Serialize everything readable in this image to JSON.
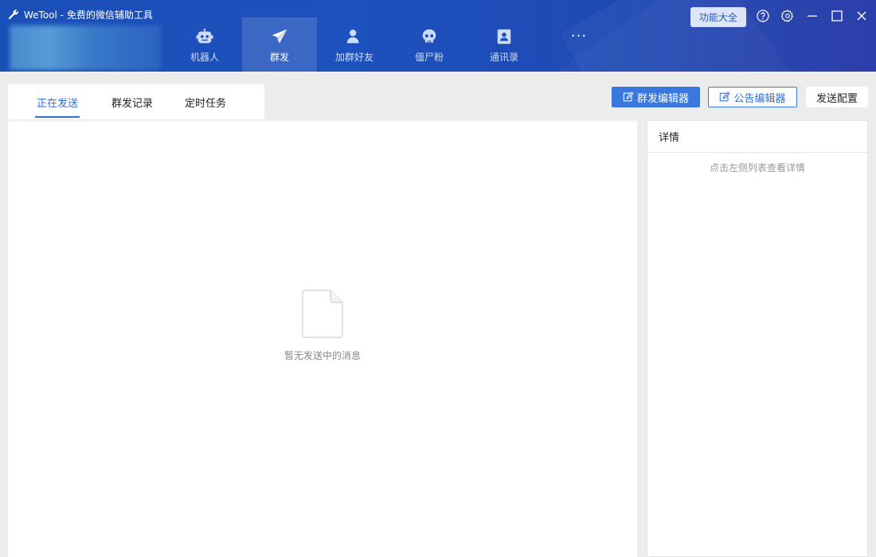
{
  "app": {
    "title": "WeTool - 免费的微信辅助工具"
  },
  "header": {
    "nav": [
      {
        "label": "机器人",
        "icon": "robot-icon"
      },
      {
        "label": "群发",
        "icon": "paper-plane-icon",
        "active": true
      },
      {
        "label": "加群好友",
        "icon": "add-user-icon"
      },
      {
        "label": "僵尸粉",
        "icon": "skull-icon"
      },
      {
        "label": "通讯录",
        "icon": "contacts-icon"
      }
    ],
    "more_label": "···",
    "func_button": "功能大全",
    "controls": [
      "help-icon",
      "settings-icon",
      "minimize-icon",
      "maximize-icon",
      "close-icon"
    ]
  },
  "subtabs": [
    {
      "label": "正在发送",
      "active": true
    },
    {
      "label": "群发记录"
    },
    {
      "label": "定时任务"
    }
  ],
  "toolbar": {
    "mass_editor": "群发编辑器",
    "notice_editor": "公告编辑器",
    "send_config": "发送配置"
  },
  "main": {
    "empty_text": "暂无发送中的消息"
  },
  "detail": {
    "title": "详情",
    "hint": "点击左侧列表查看详情"
  },
  "colors": {
    "accent": "#3a78e0",
    "header": "#1d51bd",
    "background": "#ececec"
  }
}
